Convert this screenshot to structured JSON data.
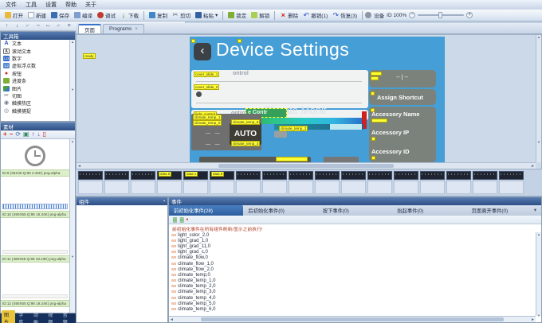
{
  "colors": {
    "screen_blue": "#459ed6",
    "tag_yellow": "#ffff33",
    "active_tab_blue": "#2b5d9e",
    "note_red": "#b04028",
    "prefix_orange": "#e07038"
  },
  "menu": {
    "items": [
      {
        "label": "文件"
      },
      {
        "label": "工具"
      },
      {
        "label": "设置"
      },
      {
        "label": "帮助"
      },
      {
        "label": "关于"
      }
    ]
  },
  "toolbar": {
    "open": "打开",
    "new": "新建",
    "save": "保存",
    "compile": "编译",
    "debug": "调试",
    "download": "下载",
    "copy": "复制",
    "cut": "剪切",
    "paste": "粘贴",
    "paste_arrow": "▾",
    "lock": "锁定",
    "unlock": "解锁",
    "delete": "删除",
    "undo": "撤销(1)",
    "redo": "恢复(3)",
    "device": "设备",
    "zoom_label": "ID 100%",
    "zoom_minus": "−",
    "zoom_plus": "+",
    "dl_glyph": "↓",
    "del_glyph": "×",
    "undo_glyph": "↶",
    "redo_glyph": "↷",
    "cut_glyph": "✂"
  },
  "align_toolbar": {
    "icons": [
      "↑",
      "↓",
      "⌐",
      "¬",
      "⌙",
      "⌐",
      "≡",
      "⋮",
      "▭",
      "▯",
      "◫",
      "⊞",
      "⊟",
      "↔",
      "↕",
      "∷"
    ]
  },
  "page_tabs": {
    "page": "页面",
    "programs": "Programs",
    "close": "×"
  },
  "toolbox": {
    "title": "工具箱",
    "items": [
      {
        "icon": "A",
        "label": "文本"
      },
      {
        "icon": "A",
        "label": "滚动文本"
      },
      {
        "icon": "123",
        "label": "数字"
      },
      {
        "icon": "1.2",
        "label": "虚拟浮点数"
      },
      {
        "icon": "●",
        "label": "按钮"
      },
      {
        "icon": "▮",
        "label": "进度条"
      },
      {
        "icon": "▦",
        "label": "图片"
      },
      {
        "icon": "✂",
        "label": "切图"
      },
      {
        "icon": "◉",
        "label": "触摸热区"
      },
      {
        "icon": "◎",
        "label": "触摸捕捉"
      }
    ]
  },
  "materials": {
    "title": "素材",
    "tools": {
      "add": "+",
      "remove": "−",
      "refresh": "⟳",
      "edit": "▣",
      "up": "↑",
      "down": "↓",
      "trash": "▯"
    },
    "items": [
      {
        "caption": "ID:9 (45X45 Q:96 2.32K) png-alpha"
      },
      {
        "caption": "ID:10 (490X55 Q:96 16.34K) png-alpha"
      },
      {
        "caption": "ID:11 (490X55 Q:96 18.43K) png-alpha"
      },
      {
        "caption": "ID:12 (490X55 Q:96 19.24K) png-alpha"
      }
    ],
    "bottom_tabs": [
      {
        "label": "图片"
      },
      {
        "label": "字库"
      },
      {
        "label": "动画"
      },
      {
        "label": "视频"
      },
      {
        "label": "音频"
      }
    ]
  },
  "canvas": {
    "ready_tag": "ready",
    "title": "Device Settings",
    "back_glyph": "‹",
    "tags": {
      "cover1": "cover_slide_1",
      "cover2": "cover_slide_2",
      "light": "light_control",
      "temp1": "climate_temp_1",
      "temp0": "climate_temp_0",
      "temp5": "climate_temp_5",
      "temp4": "climate_temp_4",
      "temp2": "climate_temp_2"
    },
    "ghost1": "ontrol",
    "ghost2": "ontrol",
    "ghost_title": "Climate Monit",
    "selection_text": "e Contr",
    "auto_label": "AUTO",
    "dashes": "—   —",
    "right_boxes": {
      "dash_value": "-- | --",
      "assign": "Assign Shortcut",
      "acc_name": "Accessory Name",
      "acc_ip": "Accessory IP",
      "acc_id": "Accessory ID"
    }
  },
  "filmstrip": {
    "cells": [
      {
        "label": ""
      },
      {
        "label": ""
      },
      {
        "label": ""
      },
      {
        "label": "data 5"
      },
      {
        "label": "data 1"
      },
      {
        "label": "data 6"
      },
      {
        "label": ""
      },
      {
        "label": ""
      },
      {
        "label": ""
      },
      {
        "label": ""
      },
      {
        "label": ""
      },
      {
        "label": ""
      },
      {
        "label": ""
      },
      {
        "label": ""
      },
      {
        "label": ""
      },
      {
        "label": ""
      },
      {
        "label": ""
      }
    ]
  },
  "components_panel": {
    "title": "组件"
  },
  "events": {
    "title": "事件",
    "tabs": [
      {
        "label": "前初始化事件(28)",
        "active": true
      },
      {
        "label": "后初始化事件(0)",
        "active": false
      },
      {
        "label": "按下事件(0)",
        "active": false
      },
      {
        "label": "抬起事件(0)",
        "active": false
      },
      {
        "label": "页面离开事件(0)",
        "active": false
      }
    ],
    "drop_glyph": "▾",
    "note": "前初始化事件在所有组件刷新/显示之前执行!",
    "entries": [
      {
        "prefix": "ws",
        "name": "light_color_2,0"
      },
      {
        "prefix": "ws",
        "name": "light_grad_1,0"
      },
      {
        "prefix": "ws",
        "name": "light_grad_11,0"
      },
      {
        "prefix": "ws",
        "name": "light_grad_c,0"
      },
      {
        "prefix": "ws",
        "name": "climate_flow,0"
      },
      {
        "prefix": "ws",
        "name": "climate_flow_1,0"
      },
      {
        "prefix": "ws",
        "name": "climate_flow_2,0"
      },
      {
        "prefix": "ws",
        "name": "climate_temp,0"
      },
      {
        "prefix": "ws",
        "name": "climate_temp_1,0"
      },
      {
        "prefix": "ws",
        "name": "climate_temp_2,0"
      },
      {
        "prefix": "ws",
        "name": "climate_temp_3,0"
      },
      {
        "prefix": "ws",
        "name": "climate_temp_4,0"
      },
      {
        "prefix": "ws",
        "name": "climate_temp_5,0"
      },
      {
        "prefix": "ws",
        "name": "climate_temp_6,0"
      }
    ]
  }
}
